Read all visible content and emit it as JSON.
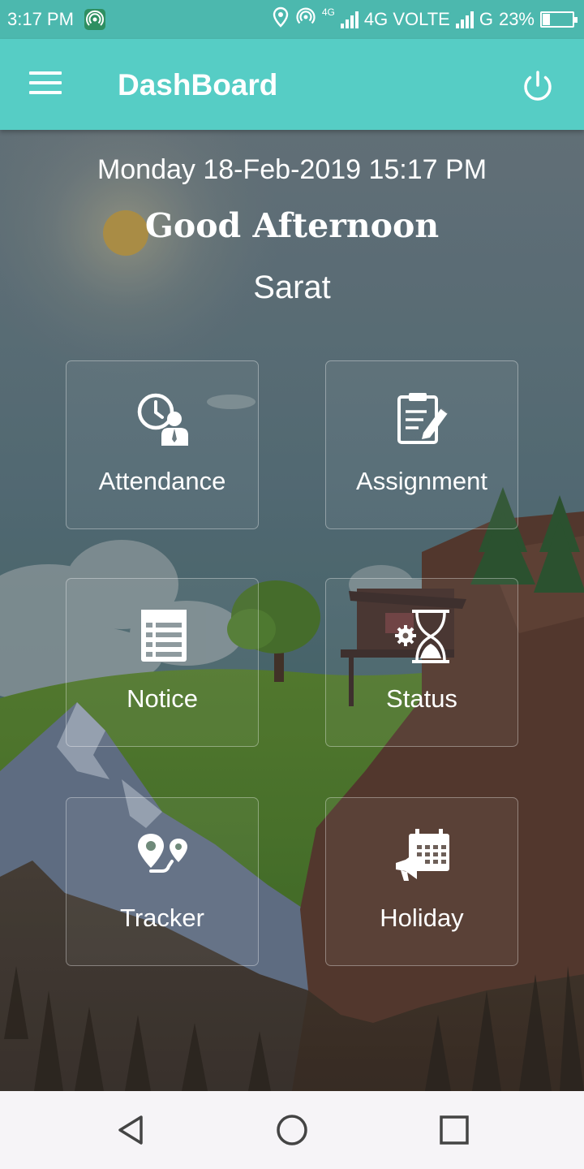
{
  "status_bar": {
    "time": "3:17 PM",
    "network1": "4G",
    "network_label": "4G VOLTE",
    "network2": "G",
    "battery_text": "23%",
    "battery_level": 0.23
  },
  "app_bar": {
    "title": "DashBoard",
    "menu_icon": "hamburger-menu-icon",
    "power_icon": "power-icon"
  },
  "header": {
    "datetime": "Monday 18-Feb-2019 15:17 PM",
    "greeting": "Good Afternoon",
    "username": "Sarat"
  },
  "tiles": [
    {
      "label": "Attendance",
      "icon": "attendance-clock-user-icon"
    },
    {
      "label": "Assignment",
      "icon": "clipboard-edit-icon"
    },
    {
      "label": "Notice",
      "icon": "notice-board-icon"
    },
    {
      "label": "Status",
      "icon": "hourglass-gear-icon"
    },
    {
      "label": "Tracker",
      "icon": "location-route-icon"
    },
    {
      "label": "Holiday",
      "icon": "calendar-megaphone-icon"
    }
  ],
  "nav_bar": {
    "back_icon": "back-triangle-icon",
    "home_icon": "home-circle-icon",
    "recents_icon": "recents-square-icon"
  },
  "colors": {
    "status_bar": "#4cb8ae",
    "app_bar": "#56cdc5",
    "text": "#ffffff"
  }
}
